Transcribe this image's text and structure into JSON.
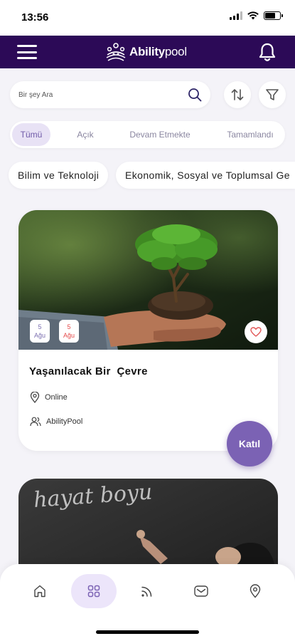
{
  "status_bar": {
    "time": "13:56",
    "battery_level": 0.7
  },
  "header": {
    "brand_bold": "Ability",
    "brand_light": "pool",
    "background": "#2c0a57",
    "icons": [
      "menu-icon",
      "ability-logo-icon",
      "bell-icon"
    ]
  },
  "search": {
    "placeholder": "Bir şey Ara",
    "value": "",
    "icons": [
      "search-icon",
      "sort-icon",
      "filter-icon"
    ]
  },
  "status_tabs": [
    {
      "label": "Tümü",
      "active": true
    },
    {
      "label": "Açık",
      "active": false
    },
    {
      "label": "Devam Etmekte",
      "active": false
    },
    {
      "label": "Tamamlandı",
      "active": false
    }
  ],
  "categories": [
    {
      "label": "Bilim ve Teknoloji"
    },
    {
      "label": "Ekonomik, Sosyal ve Toplumsal Ge"
    }
  ],
  "events": [
    {
      "title": "Yaşanılacak Bir  Çevre",
      "start_day": "5",
      "start_month": "Ağu",
      "end_day": "5",
      "end_month": "Ağu",
      "location": "Online",
      "organizer": "AbilityPool",
      "favorite": false
    },
    {
      "image_text": "hayat boyu"
    }
  ],
  "join_button": {
    "label": "Katıl",
    "color": "#7b62b4"
  },
  "bottom_nav": [
    {
      "icon": "home-icon",
      "active": false
    },
    {
      "icon": "grid-icon",
      "active": true
    },
    {
      "icon": "feed-icon",
      "active": false
    },
    {
      "icon": "mail-icon",
      "active": false
    },
    {
      "icon": "location-icon",
      "active": false
    }
  ],
  "accent": "#7b62b4"
}
